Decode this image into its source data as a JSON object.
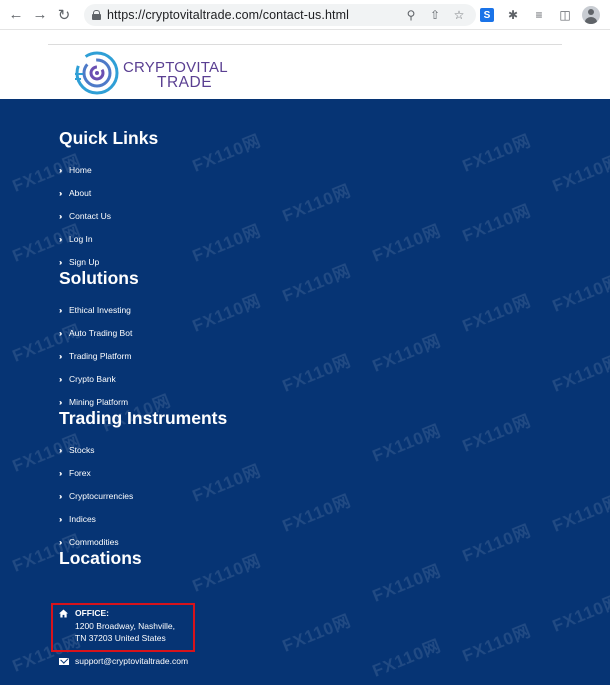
{
  "browser": {
    "url": "https://cryptovitaltrade.com/contact-us.html",
    "extension_label": "S"
  },
  "site": {
    "logo_line1": "CRYPTOVITAL",
    "logo_line2": "TRADE",
    "watermark": "FX110网"
  },
  "footer": {
    "quick_links": {
      "title": "Quick Links",
      "items": [
        "Home",
        "About",
        "Contact Us",
        "Log In",
        "Sign Up"
      ]
    },
    "solutions": {
      "title": "Solutions",
      "items": [
        "Ethical Investing",
        "Auto Trading Bot",
        "Trading Platform",
        "Crypto Bank",
        "Mining Platform"
      ]
    },
    "trading_instruments": {
      "title": "Trading Instruments",
      "items": [
        "Stocks",
        "Forex",
        "Cryptocurrencies",
        "Indices",
        "Commodities"
      ]
    },
    "locations": {
      "title": "Locations",
      "office_label": "OFFICE:",
      "address_line1": "1200 Broadway, Nashville,",
      "address_line2": "TN 37203 United States",
      "email": "support@cryptovitaltrade.com"
    }
  },
  "colors": {
    "footer_bg": "#063474",
    "highlight_border": "#d7131b",
    "logo_text": "#5a3f92"
  }
}
